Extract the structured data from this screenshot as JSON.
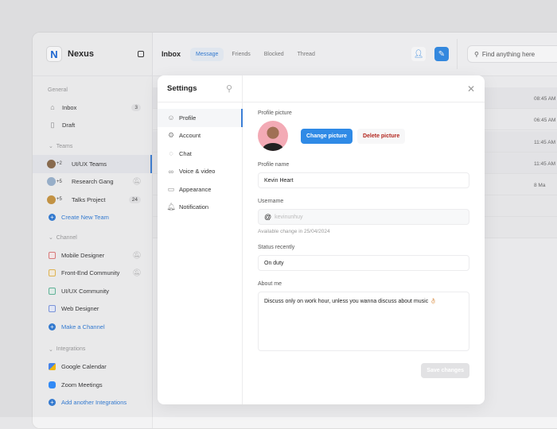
{
  "app": {
    "name": "Nexus"
  },
  "sidebar": {
    "general_label": "General",
    "inbox": {
      "label": "Inbox",
      "count": "3"
    },
    "draft": {
      "label": "Draft"
    },
    "teams_label": "Teams",
    "teams": [
      {
        "label": "UI/UX Teams",
        "extra": "+2"
      },
      {
        "label": "Research Gang",
        "extra": "+5"
      },
      {
        "label": "Talks Project",
        "extra": "+5",
        "count": "24"
      }
    ],
    "create_team": "Create New Team",
    "channel_label": "Channel",
    "channels": [
      {
        "label": "Mobile Designer",
        "color": "#e07a7a"
      },
      {
        "label": "Front-End Community",
        "color": "#e6b950"
      },
      {
        "label": "UI/UX Community",
        "color": "#5fb89a"
      },
      {
        "label": "Web Designer",
        "color": "#7b96e0"
      }
    ],
    "make_channel": "Make a Channel",
    "integrations_label": "Integrations",
    "integrations": [
      {
        "label": "Google Calendar"
      },
      {
        "label": "Zoom Meetings"
      }
    ],
    "add_integration": "Add another Integrations"
  },
  "header": {
    "title": "Inbox",
    "tabs": [
      "Message",
      "Friends",
      "Blocked",
      "Thread"
    ],
    "search_placeholder": "Find anything here"
  },
  "list": {
    "times": [
      "08:45 AM",
      "06:45 AM",
      "11:45 AM",
      "11:45 AM",
      "8 Ma"
    ]
  },
  "settings": {
    "title": "Settings",
    "nav": [
      "Profile",
      "Account",
      "Chat",
      "Voice & video",
      "Appearance",
      "Notification"
    ],
    "profile_picture_label": "Profile picture",
    "change_picture": "Change picture",
    "delete_picture": "Delete picture",
    "profile_name_label": "Profile name",
    "profile_name": "Kevin Heart",
    "username_label": "Username",
    "username": "kevinunhuy",
    "username_hint": "Available change in 25/04/2024",
    "status_label": "Status recently",
    "status": "On duty",
    "about_label": "About me",
    "about": "Discuss only on work hour, unless you wanna discuss about music 👌🏻",
    "save": "Save changes"
  },
  "colors": {
    "accent": "#2f8ae6",
    "danger": "#b3261e"
  }
}
